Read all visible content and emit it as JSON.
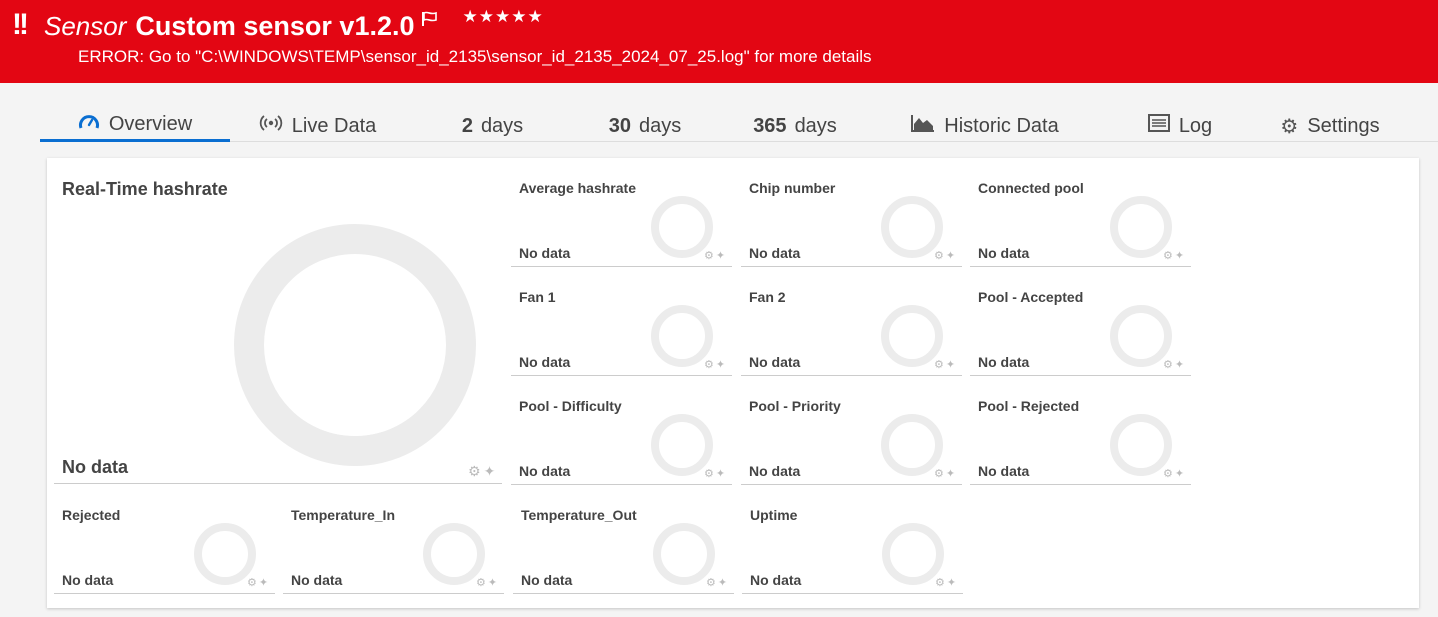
{
  "header": {
    "sensor_word": "Sensor",
    "sensor_name": "Custom sensor v1.2.0",
    "stars": "★★★★★",
    "error_text": "ERROR: Go to \"C:\\WINDOWS\\TEMP\\sensor_id_2135\\sensor_id_2135_2024_07_25.log\" for more details",
    "background_color": "#e30613"
  },
  "tabs": [
    {
      "label": "Overview",
      "icon": "speedometer-icon",
      "active": true
    },
    {
      "label": "Live Data",
      "icon": "broadcast-icon"
    },
    {
      "num": "2",
      "label": "days"
    },
    {
      "num": "30",
      "label": "days"
    },
    {
      "num": "365",
      "label": "days"
    },
    {
      "label": "Historic Data",
      "icon": "area-chart-icon"
    },
    {
      "label": "Log",
      "icon": "list-icon"
    },
    {
      "label": "Settings",
      "icon": "gear-icon"
    }
  ],
  "big_gauge": {
    "name": "Real-Time hashrate",
    "value": "No data"
  },
  "gauges": [
    {
      "name": "Average hashrate",
      "value": "No data"
    },
    {
      "name": "Chip number",
      "value": "No data"
    },
    {
      "name": "Connected pool",
      "value": "No data"
    },
    {
      "name": "Fan 1",
      "value": "No data"
    },
    {
      "name": "Fan 2",
      "value": "No data"
    },
    {
      "name": "Pool - Accepted",
      "value": "No data"
    },
    {
      "name": "Pool - Difficulty",
      "value": "No data"
    },
    {
      "name": "Pool - Priority",
      "value": "No data"
    },
    {
      "name": "Pool - Rejected",
      "value": "No data"
    },
    {
      "name": "Rejected",
      "value": "No data"
    },
    {
      "name": "Temperature_In",
      "value": "No data"
    },
    {
      "name": "Temperature_Out",
      "value": "No data"
    },
    {
      "name": "Uptime",
      "value": "No data"
    }
  ]
}
